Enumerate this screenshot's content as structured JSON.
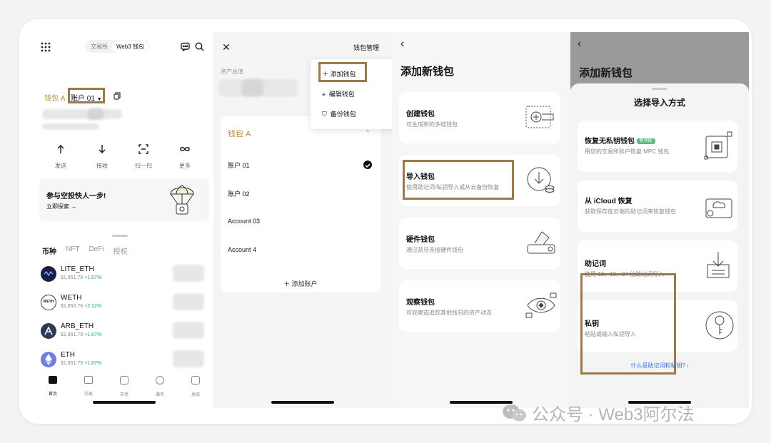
{
  "p1": {
    "toggle": [
      "交易所",
      "Web3 钱包"
    ],
    "wallet_label": "钱包 A",
    "account_label": "账户 01",
    "actions": [
      "发送",
      "接收",
      "扫一扫",
      "更多"
    ],
    "banner_title": "参与空投快人一步!",
    "banner_link": "立即探索 →",
    "tabs": [
      "币种",
      "NFT",
      "DeFi",
      "授权"
    ],
    "tokens": [
      {
        "name": "LITE_ETH",
        "price": "$1,851.79",
        "change": "+1.87%"
      },
      {
        "name": "WETH",
        "price": "$1,850.76",
        "change": "+2.12%"
      },
      {
        "name": "ARB_ETH",
        "price": "$1,851.79",
        "change": "+1.87%"
      },
      {
        "name": "ETH",
        "price": "$1,851.79",
        "change": "+1.87%"
      }
    ],
    "nav": [
      "首页",
      "交易",
      "市场",
      "赚币",
      "发现"
    ]
  },
  "p2": {
    "manage_label": "钱包管理",
    "assets_label": "资产总值",
    "menu": [
      "添加钱包",
      "编辑钱包",
      "备份钱包"
    ],
    "wallet_name": "钱包 A",
    "accounts": [
      "账户 01",
      "账户 02",
      "Account 03",
      "Account 4"
    ],
    "add_account": "添加账户"
  },
  "p3": {
    "title": "添加新钱包",
    "options": [
      {
        "title": "创建钱包",
        "desc": "可生成新的多链钱包"
      },
      {
        "title": "导入钱包",
        "desc": "使用助记词/私钥导入或从云备份恢复"
      },
      {
        "title": "硬件钱包",
        "desc": "通过蓝牙连接硬件钱包"
      },
      {
        "title": "观察钱包",
        "desc": "可观察或追踪其他钱包的资产动态"
      }
    ]
  },
  "p4": {
    "bg_title": "添加新钱包",
    "sheet_title": "选择导入方式",
    "options": [
      {
        "title": "恢复无私钥钱包",
        "badge": "新功能",
        "desc": "用您的交易所账户恢复 MPC 钱包"
      },
      {
        "title": "从 iCloud 恢复",
        "desc": "获取保存在云端的助记词来恢复钱包"
      },
      {
        "title": "助记词",
        "desc": "使用 12、18、24 位助记词导入"
      },
      {
        "title": "私钥",
        "desc": "粘贴或输入私钥导入"
      }
    ],
    "help_link": "什么是助记词和私钥? ›"
  },
  "watermark": "公众号 · Web3阿尔法",
  "colors": {
    "accent_gold": "#b98a3f",
    "highlight_border": "#9a7a4d",
    "green": "#26a96c",
    "badge": "#58b87e"
  }
}
